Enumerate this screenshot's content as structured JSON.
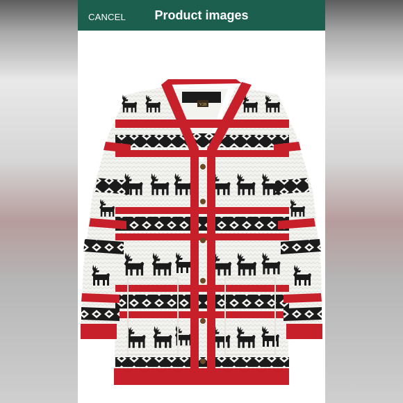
{
  "header": {
    "cancel_label": "CANCEL",
    "title": "Product images"
  },
  "image": {
    "label_tag": "V28",
    "colors": {
      "red": "#c8202a",
      "black": "#1b1b1b",
      "white": "#f3f3f0",
      "header_bg": "#1d5f4e"
    }
  }
}
